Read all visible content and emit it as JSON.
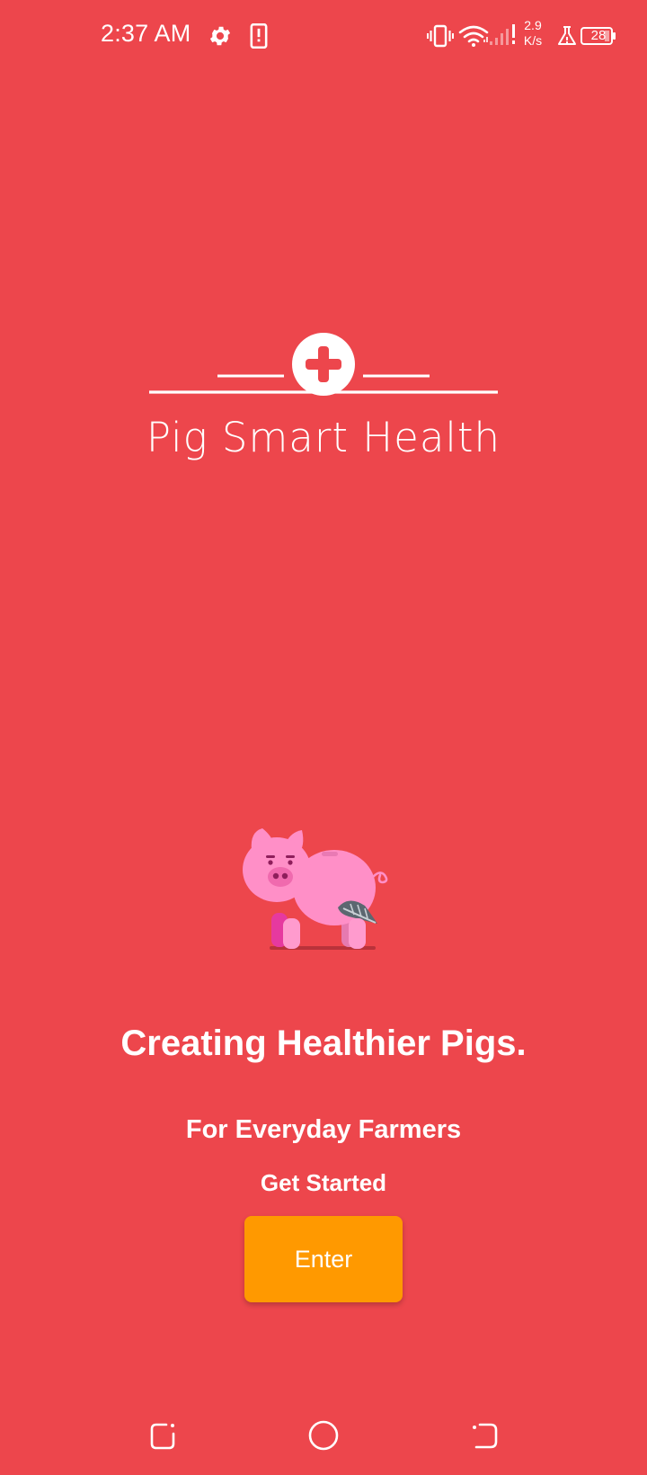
{
  "status_bar": {
    "time": "2:37 AM",
    "net_speed_value": "2.9",
    "net_speed_unit": "K/s",
    "battery_level": "28",
    "icons": [
      "gear-icon",
      "phone-alert-icon",
      "vibrate-icon",
      "wifi-icon",
      "signal-icon",
      "flask-icon",
      "battery-icon"
    ]
  },
  "logo": {
    "title": "Pig Smart Health",
    "icon": "medical-plus-icon"
  },
  "main": {
    "headline": "Creating Healthier Pigs.",
    "subtitle": "For Everyday Farmers",
    "get_started": "Get Started",
    "enter_label": "Enter"
  },
  "nav_bar": {
    "icons": [
      "recents-icon",
      "home-icon",
      "back-icon"
    ]
  },
  "colors": {
    "background": "#ED464C",
    "button": "#FF9900",
    "text": "#FFFFFF",
    "pig": "#FF8FC7"
  }
}
